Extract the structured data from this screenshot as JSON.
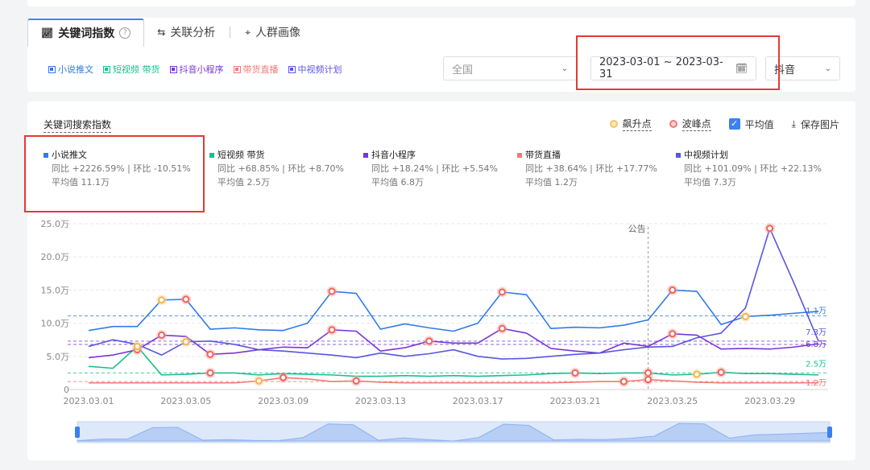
{
  "tabs": [
    {
      "label": "关键词指数",
      "icon": "trend-icon",
      "active": true
    },
    {
      "label": "关联分析",
      "icon": "link-icon",
      "active": false
    },
    {
      "label": "人群画像",
      "icon": "people-icon",
      "active": false
    }
  ],
  "tab_help": "?",
  "keyword_tags": [
    {
      "label": "小说推文",
      "color": "#2f7be8"
    },
    {
      "label": "短视频 带货",
      "color": "#1bbf8f"
    },
    {
      "label": "抖音小程序",
      "color": "#7a35d6"
    },
    {
      "label": "带货直播",
      "color": "#f07a74"
    },
    {
      "label": "中视频计划",
      "color": "#5a55e0"
    }
  ],
  "filters": {
    "region": "全国",
    "date_range": "2023-03-01 ~ 2023-03-31",
    "platform": "抖音"
  },
  "chart_title": "关键词搜索指数",
  "tools": {
    "rise": "飙升点",
    "peak": "波峰点",
    "avg": "平均值",
    "save": "保存图片"
  },
  "legend": [
    {
      "name": "小说推文",
      "color": "#2f7be8",
      "stats": "同比 +2226.59% | 环比 -10.51%",
      "avg": "平均值 11.1万"
    },
    {
      "name": "短视频 带货",
      "color": "#1bbf8f",
      "stats": "同比 +68.85% | 环比 +8.70%",
      "avg": "平均值 2.5万"
    },
    {
      "name": "抖音小程序",
      "color": "#7a35d6",
      "stats": "同比 +18.24% | 环比 +5.54%",
      "avg": "平均值 6.8万"
    },
    {
      "name": "带货直播",
      "color": "#f07a74",
      "stats": "同比 +38.64% | 环比 +17.77%",
      "avg": "平均值 1.2万"
    },
    {
      "name": "中视频计划",
      "color": "#5a55e0",
      "stats": "同比 +101.09% | 环比 +22.13%",
      "avg": "平均值 7.3万"
    }
  ],
  "chart_data": {
    "type": "line",
    "x": [
      "2023.03.01",
      "2023.03.02",
      "2023.03.03",
      "2023.03.04",
      "2023.03.05",
      "2023.03.06",
      "2023.03.07",
      "2023.03.08",
      "2023.03.09",
      "2023.03.10",
      "2023.03.11",
      "2023.03.12",
      "2023.03.13",
      "2023.03.14",
      "2023.03.15",
      "2023.03.16",
      "2023.03.17",
      "2023.03.18",
      "2023.03.19",
      "2023.03.20",
      "2023.03.21",
      "2023.03.22",
      "2023.03.23",
      "2023.03.24",
      "2023.03.25",
      "2023.03.26",
      "2023.03.27",
      "2023.03.28",
      "2023.03.29",
      "2023.03.30",
      "2023.03.31"
    ],
    "x_tick_labels": [
      "2023.03.01",
      "2023.03.05",
      "2023.03.09",
      "2023.03.13",
      "2023.03.17",
      "2023.03.21",
      "2023.03.25",
      "2023.03.29"
    ],
    "y_ticks": [
      "0",
      "5.0万",
      "10.0万",
      "15.0万",
      "20.0万",
      "25.0万"
    ],
    "ylim": [
      0,
      25
    ],
    "y_unit": "万",
    "grid": true,
    "annotation": {
      "label": "公告",
      "x": "2023.03.24"
    },
    "series": [
      {
        "name": "小说推文",
        "color": "#2f7be8",
        "values": [
          8.9,
          9.5,
          9.5,
          13.5,
          13.6,
          9.1,
          9.3,
          9.0,
          8.9,
          10.0,
          14.8,
          14.5,
          9.1,
          9.9,
          9.3,
          8.8,
          10.0,
          14.7,
          14.3,
          9.2,
          9.4,
          9.3,
          9.7,
          10.5,
          15.0,
          14.8,
          9.8,
          11.0,
          11.2,
          11.5,
          11.8
        ],
        "avg": 11.1,
        "avg_label": "1.1万"
      },
      {
        "name": "短视频 带货",
        "color": "#1bbf8f",
        "values": [
          3.5,
          3.2,
          6.5,
          2.2,
          2.3,
          2.5,
          2.5,
          2.2,
          2.4,
          2.3,
          2.2,
          2.0,
          2.0,
          2.1,
          2.0,
          2.1,
          2.0,
          2.1,
          2.2,
          2.4,
          2.5,
          2.4,
          2.5,
          2.5,
          2.2,
          2.3,
          2.6,
          2.4,
          2.4,
          2.3,
          2.2
        ],
        "avg": 2.5,
        "avg_label": "2.5万"
      },
      {
        "name": "抖音小程序",
        "color": "#7a35d6",
        "values": [
          4.8,
          5.2,
          6.0,
          8.2,
          8.0,
          5.3,
          5.5,
          6.0,
          6.4,
          6.3,
          9.0,
          8.8,
          5.8,
          6.3,
          7.3,
          7.0,
          7.0,
          9.2,
          8.5,
          6.2,
          5.8,
          5.5,
          7.0,
          6.5,
          8.4,
          8.2,
          6.1,
          6.2,
          6.1,
          6.4,
          6.9
        ],
        "avg": 6.8,
        "avg_label": "6.8万"
      },
      {
        "name": "带货直播",
        "color": "#f07a74",
        "values": [
          1.0,
          1.0,
          1.0,
          1.0,
          1.0,
          1.0,
          1.0,
          1.3,
          1.8,
          1.6,
          1.2,
          1.3,
          1.1,
          1.0,
          1.0,
          1.0,
          1.0,
          1.0,
          1.0,
          1.0,
          1.1,
          1.2,
          1.2,
          1.5,
          1.3,
          1.1,
          1.0,
          1.0,
          1.0,
          1.0,
          1.0
        ],
        "avg": 1.2,
        "avg_label": "1.2万"
      },
      {
        "name": "中视频计划",
        "color": "#5a55e0",
        "values": [
          6.5,
          7.5,
          6.8,
          5.2,
          7.2,
          7.3,
          6.8,
          6.0,
          5.8,
          5.5,
          5.2,
          4.8,
          5.5,
          5.0,
          5.4,
          6.0,
          5.0,
          4.6,
          4.7,
          5.0,
          5.3,
          5.5,
          6.0,
          6.4,
          6.5,
          7.8,
          8.5,
          12.3,
          24.3,
          16.0,
          7.3
        ],
        "avg": 7.3,
        "avg_label": "7.3万"
      }
    ],
    "peak_points": [
      {
        "series": 0,
        "x": 4
      },
      {
        "series": 0,
        "x": 10
      },
      {
        "series": 0,
        "x": 17
      },
      {
        "series": 0,
        "x": 24
      },
      {
        "series": 1,
        "x": 5
      },
      {
        "series": 1,
        "x": 20
      },
      {
        "series": 1,
        "x": 23
      },
      {
        "series": 1,
        "x": 26
      },
      {
        "series": 2,
        "x": 2
      },
      {
        "series": 2,
        "x": 3
      },
      {
        "series": 2,
        "x": 5
      },
      {
        "series": 2,
        "x": 10
      },
      {
        "series": 2,
        "x": 14
      },
      {
        "series": 2,
        "x": 17
      },
      {
        "series": 2,
        "x": 24
      },
      {
        "series": 3,
        "x": 8
      },
      {
        "series": 3,
        "x": 11
      },
      {
        "series": 3,
        "x": 22
      },
      {
        "series": 3,
        "x": 23
      },
      {
        "series": 4,
        "x": 28
      }
    ],
    "rise_points": [
      {
        "series": 0,
        "x": 3
      },
      {
        "series": 0,
        "x": 27
      },
      {
        "series": 1,
        "x": 2
      },
      {
        "series": 1,
        "x": 25
      },
      {
        "series": 3,
        "x": 7
      },
      {
        "series": 4,
        "x": 4
      }
    ]
  }
}
